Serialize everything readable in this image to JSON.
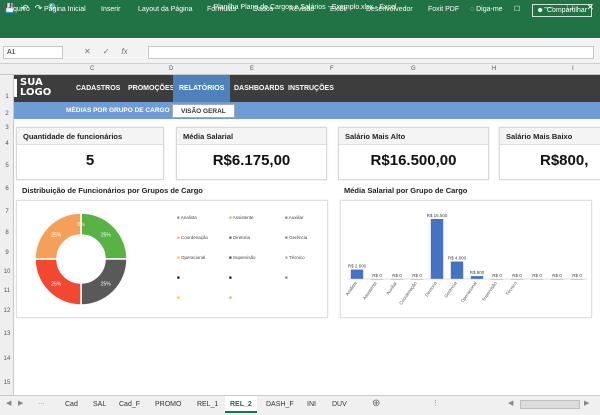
{
  "window": {
    "title": "Planilha Plano de Cargos e Salários - Exemplo.xlsx - Excel"
  },
  "ribbon": {
    "tabs": [
      "Arquivo",
      "Página Inicial",
      "Inserir",
      "Layout da Página",
      "Fórmulas",
      "Dados",
      "Revisão",
      "Exibir",
      "Desenvolvedor",
      "Foxit PDF"
    ],
    "tell_me": "Diga-me",
    "share": "Compartilhar"
  },
  "formula_bar": {
    "name_box": "A1",
    "fx": "fx",
    "formula": ""
  },
  "columns": [
    "C",
    "D",
    "E",
    "F",
    "G",
    "H",
    "I"
  ],
  "rows": [
    "1",
    "2",
    "3",
    "4",
    "5",
    "6",
    "7",
    "8",
    "9",
    "10",
    "11",
    "12",
    "13",
    "14",
    "15"
  ],
  "logo": {
    "line1": "SUA",
    "line2": "LOGO"
  },
  "nav": {
    "items": [
      "CADASTROS",
      "PROMOÇÕES",
      "RELATÓRIOS",
      "DASHBOARDS",
      "INSTRUÇÕES"
    ],
    "active": "RELATÓRIOS"
  },
  "subnav": {
    "items": [
      "MÉDIAS POR GRUPO DE CARGO",
      "VISÃO GERAL"
    ],
    "active": "VISÃO GERAL"
  },
  "kpis": [
    {
      "title": "Quantidade de funcionários",
      "value": "5"
    },
    {
      "title": "Média Salarial",
      "value": "R$6.175,00"
    },
    {
      "title": "Salário Mais Alto",
      "value": "R$16.500,00"
    },
    {
      "title": "Salário Mais Baixo",
      "value": "R$800,"
    }
  ],
  "donut": {
    "title": "Distribuição de Funcionários por Grupos de Cargo",
    "legend": [
      {
        "label": "Analista",
        "color": "#888888"
      },
      {
        "label": "Assistente",
        "color": "#92d050"
      },
      {
        "label": "Auxiliar",
        "color": "#7f7f7f"
      },
      {
        "label": "Coordenação",
        "color": "#f4b183"
      },
      {
        "label": "Diretoria",
        "color": "#595959"
      },
      {
        "label": "Gerência",
        "color": "#7f7f7f"
      },
      {
        "label": "Operacional",
        "color": "#ffc000"
      },
      {
        "label": "Supervisão",
        "color": "#404040"
      },
      {
        "label": "Técnico",
        "color": "#a6a6a6"
      },
      {
        "label": "",
        "color": "#000000"
      },
      {
        "label": "",
        "color": "#000000"
      },
      {
        "label": "",
        "color": "#7f7f7f"
      },
      {
        "label": "",
        "color": "#ffc000"
      },
      {
        "label": "",
        "color": "#92d050"
      }
    ]
  },
  "chart_data": {
    "type": "bar",
    "title": "Média Salarial por Grupo de Cargo",
    "categories": [
      "Analista",
      "Assistente",
      "Auxiliar",
      "Coordenação",
      "Diretoria",
      "Gerência",
      "Operacional",
      "Supervisão",
      "Técnico",
      "",
      "",
      ""
    ],
    "values": [
      2600,
      0,
      0,
      0,
      16500,
      4800,
      800,
      0,
      0,
      0,
      0,
      0
    ],
    "data_labels": [
      "R$ 2.600",
      "R$ 0",
      "R$ 0",
      "R$ 0",
      "R$ 16.500",
      "R$ 4.800",
      "R$ 800",
      "R$ 0",
      "R$ 0",
      "R$ 0",
      "R$ 0",
      "R$ 0"
    ],
    "color": "#4472c4",
    "ylim": [
      0,
      16500
    ]
  },
  "donut_data": {
    "type": "pie",
    "values": [
      25,
      25,
      25,
      25,
      0
    ],
    "labels": [
      "25%",
      "25%",
      "25%",
      "25%",
      "0%"
    ],
    "colors": [
      "#58b244",
      "#595959",
      "#f4472f",
      "#f4a05a",
      "#92d050"
    ]
  },
  "sheets": {
    "tabs": [
      "Cad",
      "SAL",
      "Cad_F",
      "PROMO",
      "REL_1",
      "REL_2",
      "DASH_F",
      "INI",
      "DUV"
    ],
    "active": "REL_2"
  }
}
